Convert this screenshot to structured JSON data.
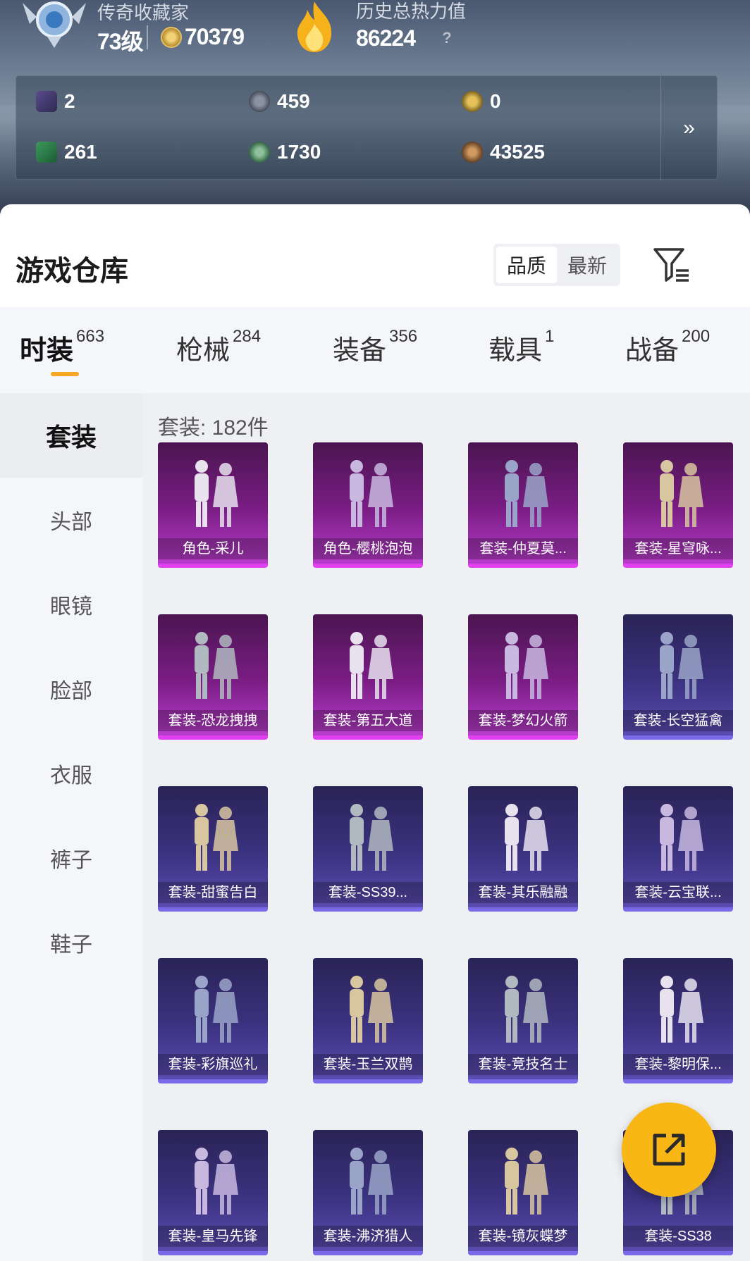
{
  "header": {
    "rank_title": "传奇收藏家",
    "level": "73级",
    "coins": "70379",
    "heat_title": "历史总热力值",
    "heat_value": "86224",
    "help": "?"
  },
  "stats": [
    {
      "icon": "purple-card-icon",
      "value": "2"
    },
    {
      "icon": "grey-medal-icon",
      "value": "459"
    },
    {
      "icon": "gold-medal-icon",
      "value": "0"
    },
    {
      "icon": "green-card-icon",
      "value": "261"
    },
    {
      "icon": "green-orb-icon",
      "value": "1730"
    },
    {
      "icon": "bronze-orb-icon",
      "value": "43525"
    }
  ],
  "stats_more": "»",
  "warehouse": {
    "title": "游戏仓库",
    "sort_options": [
      "品质",
      "最新"
    ]
  },
  "tabs": [
    {
      "label": "时装",
      "count": "663"
    },
    {
      "label": "枪械",
      "count": "284"
    },
    {
      "label": "装备",
      "count": "356"
    },
    {
      "label": "载具",
      "count": "1"
    },
    {
      "label": "战备",
      "count": "200"
    }
  ],
  "sidebar": [
    "套装",
    "头部",
    "眼镜",
    "脸部",
    "衣服",
    "裤子",
    "鞋子"
  ],
  "count_label": "套装: 182件",
  "items": [
    {
      "label": "角色-采儿",
      "rarity": "pink"
    },
    {
      "label": "角色-樱桃泡泡",
      "rarity": "pink"
    },
    {
      "label": "套装-仲夏莫...",
      "rarity": "pink"
    },
    {
      "label": "套装-星穹咏...",
      "rarity": "pink"
    },
    {
      "label": "套装-恐龙拽拽",
      "rarity": "pink"
    },
    {
      "label": "套装-第五大道",
      "rarity": "pink"
    },
    {
      "label": "套装-梦幻火箭",
      "rarity": "pink"
    },
    {
      "label": "套装-长空猛禽",
      "rarity": "blue"
    },
    {
      "label": "套装-甜蜜告白",
      "rarity": "blue"
    },
    {
      "label": "套装-SS39...",
      "rarity": "blue"
    },
    {
      "label": "套装-其乐融融",
      "rarity": "blue"
    },
    {
      "label": "套装-云宝联...",
      "rarity": "blue"
    },
    {
      "label": "套装-彩旗巡礼",
      "rarity": "blue"
    },
    {
      "label": "套装-玉兰双鹊",
      "rarity": "blue"
    },
    {
      "label": "套装-竞技名士",
      "rarity": "blue"
    },
    {
      "label": "套装-黎明保...",
      "rarity": "blue"
    },
    {
      "label": "套装-皇马先锋",
      "rarity": "blue"
    },
    {
      "label": "套装-沸济猎人",
      "rarity": "blue"
    },
    {
      "label": "套装-镜灰蝶梦",
      "rarity": "blue"
    },
    {
      "label": "套装-SS38",
      "rarity": "blue"
    }
  ],
  "colors": {
    "accent": "#f6a825",
    "fab": "#f8b715",
    "pink_rarity": "#e040f0",
    "blue_rarity": "#7a6ae8"
  }
}
